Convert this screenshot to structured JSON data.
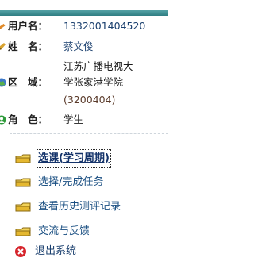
{
  "user_info": {
    "username_label": "用户名：",
    "username": "1332001404520",
    "name_label": "姓　名：",
    "name": "蔡文俊",
    "region_label": "区　域：",
    "region_line1": "江苏广播电视大",
    "region_line2": "学张家港学院",
    "region_code": "(3200404)",
    "role_label": "角　色：",
    "role": "学生"
  },
  "menu": {
    "items": [
      {
        "label": "选课(学习周期)",
        "icon": "folder-hand-icon",
        "active": true
      },
      {
        "label": "选择/完成任务",
        "icon": "folder-hand-icon"
      },
      {
        "label": "查看历史测评记录",
        "icon": "folder-hand-icon"
      },
      {
        "label": "交流与反馈",
        "icon": "folder-hand-icon"
      },
      {
        "label": "退出系统",
        "icon": "red-x-icon"
      }
    ]
  },
  "colors": {
    "topbar": "#3d8c90",
    "link": "#1a4f82",
    "exit_icon": "#d6252c"
  }
}
